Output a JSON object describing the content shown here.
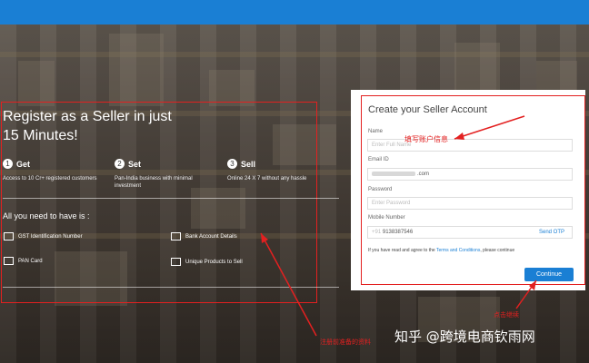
{
  "hero": {
    "headline_line1": "Register as a Seller in just",
    "headline_line2": "15 Minutes!",
    "steps": [
      {
        "num": "1",
        "title": "Get",
        "desc": "Access to 10 Cr+ registered customers"
      },
      {
        "num": "2",
        "title": "Set",
        "desc": "Pan-India business with minimal investment"
      },
      {
        "num": "3",
        "title": "Sell",
        "desc": "Online 24 X 7 without any hassle"
      }
    ],
    "need_title": "All you need to have is :",
    "requirements": [
      {
        "label": "GST Identification Number",
        "icon": "document-icon"
      },
      {
        "label": "Bank Account Details",
        "icon": "bank-icon"
      },
      {
        "label": "PAN Card",
        "icon": "card-icon"
      },
      {
        "label": "Unique Products to Sell",
        "icon": "box-icon"
      }
    ]
  },
  "form": {
    "title": "Create your Seller Account",
    "name_label": "Name",
    "name_placeholder": "Enter Full Name",
    "email_label": "Email ID",
    "email_value": ".com",
    "password_label": "Password",
    "password_placeholder": "Enter Password",
    "mobile_label": "Mobile Number",
    "mobile_prefix": "+91",
    "mobile_value": "9138387546",
    "send_otp": "Send OTP",
    "terms_prefix": "If you have read and agree to the ",
    "terms_link": "Terms and Conditions",
    "terms_suffix": ", please continue",
    "continue_label": "Continue"
  },
  "annotations": {
    "fill_info": "填写账户信息",
    "click_continue": "点击继续",
    "left_note": "注册前准备的资料"
  },
  "watermark": "知乎 @跨境电商钦雨网",
  "colors": {
    "accent": "#1a7fd4",
    "annotation": "#e32020"
  }
}
